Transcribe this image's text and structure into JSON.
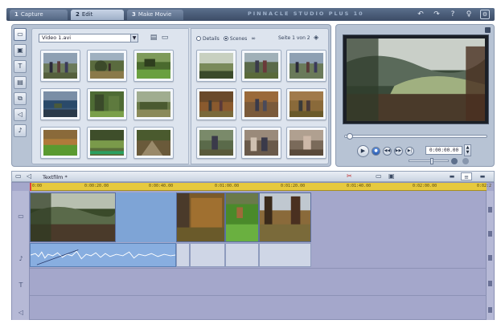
{
  "tabs": [
    {
      "num": "1",
      "label": "Capture"
    },
    {
      "num": "2",
      "label": "Edit"
    },
    {
      "num": "3",
      "label": "Make Movie"
    }
  ],
  "app_title": "PINNACLE STUDIO PLUS 10",
  "album": {
    "dropdown_value": "Video 1.avi",
    "radio_details": "Details",
    "radio_scenes": "Scenes",
    "page_info": "Seite 1 von 2"
  },
  "preview": {
    "timecode": "0:00:00.00"
  },
  "timeline": {
    "project_name": "Textfilm *",
    "ruler_ticks": [
      "0:00",
      "0:00:20.00",
      "0:00:40.00",
      "0:01:00.00",
      "0:01:20.00",
      "0:01:40.00",
      "0:02:00.00",
      "0:02:2"
    ]
  },
  "colors": {
    "accent": "#5b6f8c",
    "ruler": "#e6c93e",
    "timeline_bg": "#a4a7cb",
    "video_gap": "#7ea4d6"
  },
  "icons": {
    "side_tools": [
      "camera-icon",
      "photo-icon",
      "title-icon",
      "menu-icon",
      "transition-icon",
      "sound-icon",
      "music-icon"
    ],
    "toolbar": [
      "undo-icon",
      "redo-icon",
      "help-icon",
      "bulb-icon",
      "settings-icon"
    ]
  }
}
